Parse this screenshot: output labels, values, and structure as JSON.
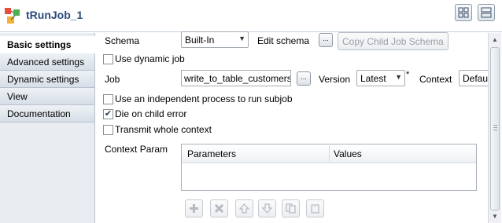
{
  "header": {
    "title": "tRunJob_1"
  },
  "sidebar": {
    "tabs": [
      {
        "label": "Basic settings",
        "active": true
      },
      {
        "label": "Advanced settings",
        "active": false
      },
      {
        "label": "Dynamic settings",
        "active": false
      },
      {
        "label": "View",
        "active": false
      },
      {
        "label": "Documentation",
        "active": false
      }
    ]
  },
  "form": {
    "schema_label": "Schema",
    "schema_value": "Built-In",
    "edit_schema_label": "Edit schema",
    "copy_child_job_schema_button": "Copy Child Job Schema",
    "use_dynamic_job_label": "Use dynamic job",
    "use_dynamic_job_checked": false,
    "job_label": "Job",
    "job_value": "write_to_table_customers",
    "version_label": "Version",
    "version_value": "Latest",
    "version_required_marker": "*",
    "context_label": "Context",
    "context_value": "Default",
    "independent_process_label": "Use an independent process to run subjob",
    "independent_process_checked": false,
    "die_on_child_error_label": "Die on child error",
    "die_on_child_error_checked": true,
    "transmit_context_label": "Transmit whole context",
    "transmit_context_checked": false,
    "context_param_label": "Context Param",
    "table_headers": [
      "Parameters",
      "Values"
    ]
  },
  "table_toolbar": {
    "buttons": [
      "add-icon",
      "remove-icon",
      "move-up-icon",
      "move-down-icon",
      "copy-icon",
      "paste-icon"
    ]
  },
  "colors": {
    "title": "#2a4a7a",
    "sidebar": "#e9edf2",
    "check": "#2b3b55"
  }
}
